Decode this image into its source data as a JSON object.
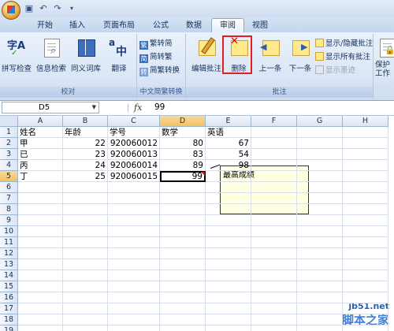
{
  "qat": {
    "icons": [
      "save-icon",
      "undo-icon",
      "redo-icon",
      "dropdown-icon"
    ]
  },
  "tabs": [
    {
      "label": "开始",
      "active": false
    },
    {
      "label": "插入",
      "active": false
    },
    {
      "label": "页面布局",
      "active": false
    },
    {
      "label": "公式",
      "active": false
    },
    {
      "label": "数据",
      "active": false
    },
    {
      "label": "审阅",
      "active": true
    },
    {
      "label": "视图",
      "active": false
    }
  ],
  "ribbon": {
    "proofing": {
      "group_label": "校对",
      "spell": "拼写检查",
      "research": "信息检索",
      "thesaurus": "同义词库",
      "translate": "翻译"
    },
    "chinese": {
      "group_label": "中文简繁转换",
      "to_simp": "繁转简",
      "to_trad": "简转繁",
      "convert": "简繁转换"
    },
    "comments": {
      "group_label": "批注",
      "edit": "编辑批注",
      "delete": "删除",
      "prev": "上一条",
      "next": "下一条",
      "show_hide": "显示/隐藏批注",
      "show_all": "显示所有批注",
      "show_ink": "显示墨迹"
    },
    "protect": {
      "label": "保护工作"
    }
  },
  "formula_bar": {
    "cell_ref": "D5",
    "fx": "fx",
    "value": "99"
  },
  "columns": [
    "A",
    "B",
    "C",
    "D",
    "E",
    "F",
    "G",
    "H"
  ],
  "selected_column": "D",
  "rows": [
    "1",
    "2",
    "3",
    "4",
    "5",
    "6",
    "7",
    "8",
    "9",
    "10",
    "11",
    "12",
    "13",
    "14",
    "15",
    "16",
    "17",
    "18",
    "19"
  ],
  "selected_row": "5",
  "table": [
    [
      "姓名",
      "年龄",
      "学号",
      "数学",
      "英语"
    ],
    [
      "甲",
      "22",
      "920060012",
      "80",
      "67"
    ],
    [
      "已",
      "23",
      "920060013",
      "83",
      "54"
    ],
    [
      "丙",
      "24",
      "920060014",
      "89",
      "98"
    ],
    [
      "丁",
      "25",
      "920060015",
      "99",
      ""
    ]
  ],
  "comment": {
    "text": "最高成绩"
  },
  "watermark": {
    "line1": "jb51.net",
    "line2": "脚本之家"
  }
}
